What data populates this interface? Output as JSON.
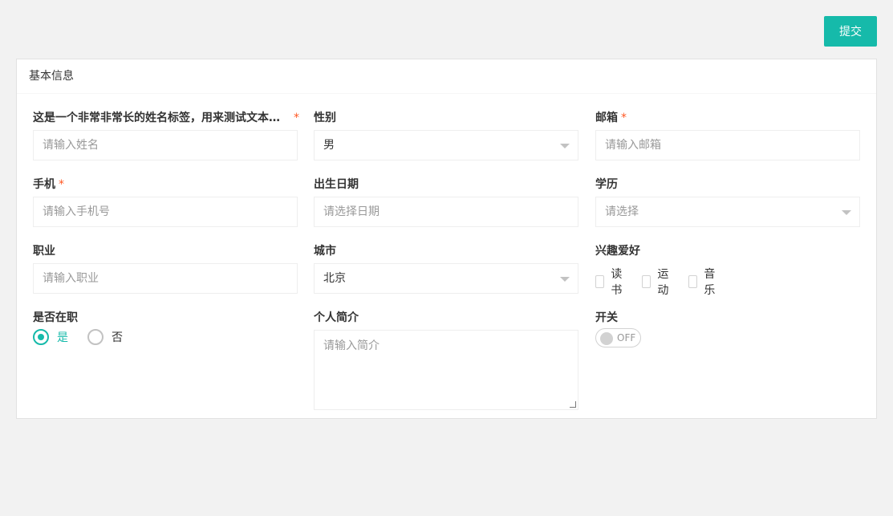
{
  "toolbar": {
    "submit_label": "提交"
  },
  "card": {
    "title": "基本信息"
  },
  "form": {
    "name": {
      "label": "这是一个非常非常长的姓名标签，用来测试文本…",
      "required": "*",
      "placeholder": "请输入姓名"
    },
    "gender": {
      "label": "性别",
      "value": "男"
    },
    "email": {
      "label": "邮箱",
      "required": "*",
      "placeholder": "请输入邮箱"
    },
    "phone": {
      "label": "手机",
      "required": "*",
      "placeholder": "请输入手机号"
    },
    "birthdate": {
      "label": "出生日期",
      "placeholder": "请选择日期"
    },
    "education": {
      "label": "学历",
      "placeholder": "请选择"
    },
    "occupation": {
      "label": "职业",
      "placeholder": "请输入职业"
    },
    "city": {
      "label": "城市",
      "value": "北京"
    },
    "hobbies": {
      "label": "兴趣爱好",
      "options": [
        "读书",
        "运动",
        "音乐"
      ]
    },
    "employed": {
      "label": "是否在职",
      "options": [
        "是",
        "否"
      ],
      "selected": "是"
    },
    "bio": {
      "label": "个人简介",
      "placeholder": "请输入简介"
    },
    "switch": {
      "label": "开关",
      "state": "OFF"
    }
  },
  "colors": {
    "accent": "#16baaa",
    "required": "#ff5722"
  }
}
